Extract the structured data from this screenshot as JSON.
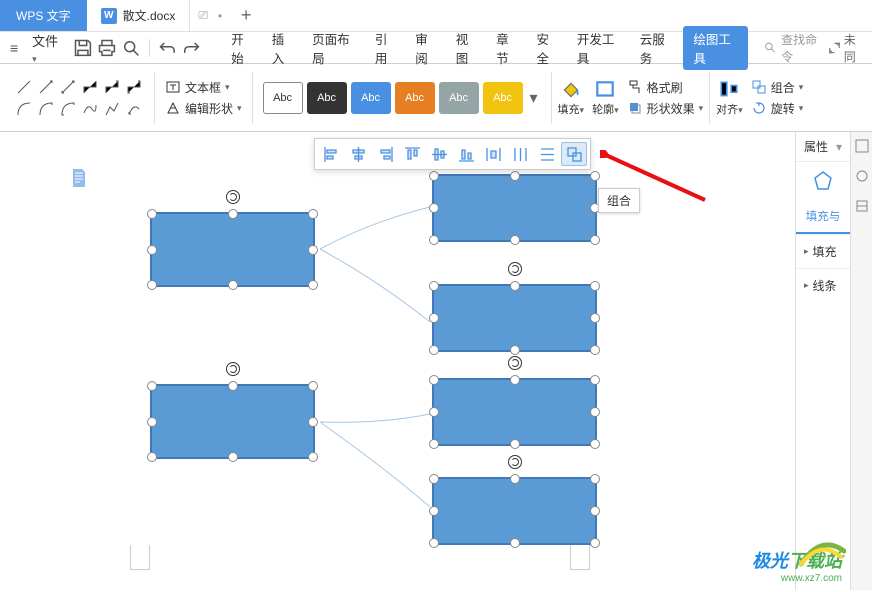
{
  "app_name": "WPS 文字",
  "doc_name": "散文.docx",
  "file_menu": "文件",
  "menu_tabs": [
    "开始",
    "插入",
    "页面布局",
    "引用",
    "审阅",
    "视图",
    "章节",
    "安全",
    "开发工具",
    "云服务",
    "绘图工具"
  ],
  "search_placeholder": "查找命令",
  "sync_label": "未同",
  "textbox_label": "文本框",
  "edit_shape_label": "编辑形状",
  "shape_style_label": "Abc",
  "fill_label": "填充",
  "outline_label": "轮廓",
  "effect_label": "形状效果",
  "format_painter": "格式刷",
  "align_label": "对齐",
  "group_label": "组合",
  "rotate_label": "旋转",
  "tooltip": "组合",
  "prop_header": "属性",
  "prop_tab": "填充与",
  "prop_fill": "填充",
  "prop_line": "线条",
  "watermark_text1": "极光",
  "watermark_text2": "下载站",
  "watermark_url": "www.xz7.com"
}
